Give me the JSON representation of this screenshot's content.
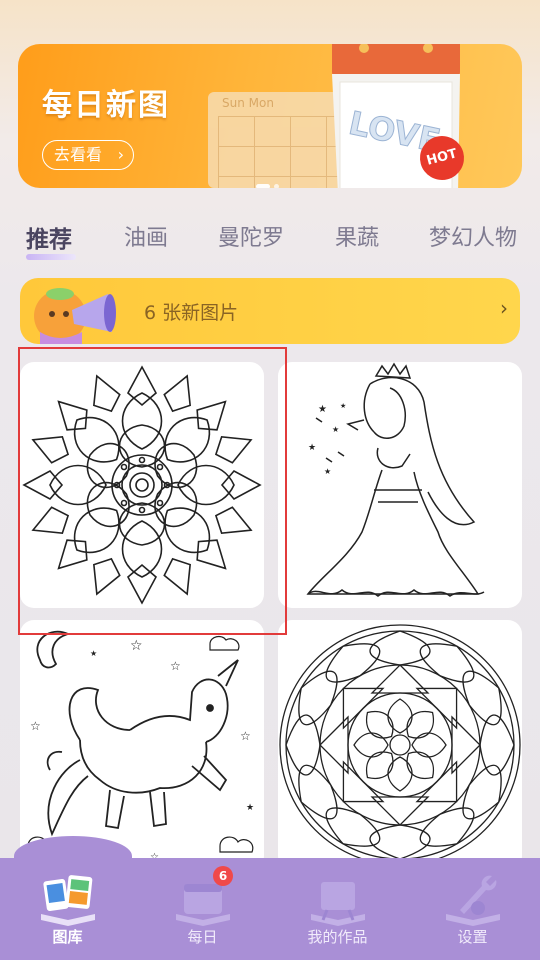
{
  "banner": {
    "title": "每日新图",
    "button_label": "去看看",
    "calendar_days": "Sun    Mon",
    "hot_badge": "HOT",
    "sheet_text": "LOVE"
  },
  "tabs": [
    {
      "label": "推荐",
      "active": true
    },
    {
      "label": "油画",
      "active": false
    },
    {
      "label": "曼陀罗",
      "active": false
    },
    {
      "label": "果蔬",
      "active": false
    },
    {
      "label": "梦幻人物",
      "active": false
    }
  ],
  "notice": {
    "text": "6 张新图片"
  },
  "gallery": [
    {
      "subject": "mandala-flower",
      "selected": true
    },
    {
      "subject": "princess"
    },
    {
      "subject": "unicorn"
    },
    {
      "subject": "mandala-round"
    }
  ],
  "nav": [
    {
      "label": "图库",
      "icon": "gallery-icon",
      "active": true
    },
    {
      "label": "每日",
      "icon": "daily-icon",
      "badge": "6"
    },
    {
      "label": "我的作品",
      "icon": "my-works-icon"
    },
    {
      "label": "设置",
      "icon": "settings-icon"
    }
  ],
  "colors": {
    "accent": "#a98fd6",
    "banner": "#ff9d1a",
    "notice": "#ffc83a",
    "highlight": "#e23b3b"
  }
}
